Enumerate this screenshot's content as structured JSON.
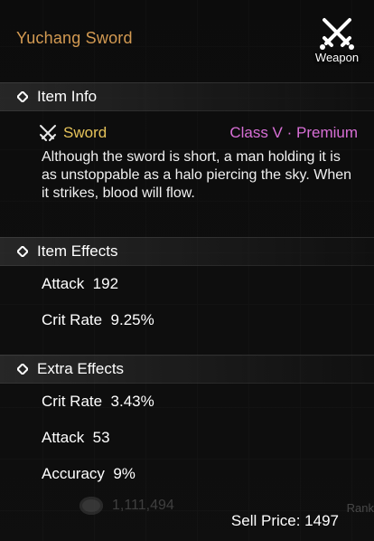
{
  "item": {
    "name": "Yuchang Sword",
    "category_badge": "Weapon",
    "type": "Sword",
    "class_grade": "Class V · Premium",
    "description": "Although the sword is short, a man holding it is as unstoppable as a halo piercing the sky. When it strikes, blood will flow."
  },
  "sections": {
    "info": "Item Info",
    "effects": "Item Effects",
    "extra": "Extra Effects"
  },
  "item_effects": [
    {
      "label": "Attack  192"
    },
    {
      "label": "Crit Rate  9.25%"
    }
  ],
  "extra_effects": [
    {
      "label": "Crit Rate  3.43%"
    },
    {
      "label": "Attack  53"
    },
    {
      "label": "Accuracy  9%"
    }
  ],
  "background": {
    "money": "1,111,494",
    "rank_label": "Rank"
  },
  "footer": {
    "sell_price": "Sell Price: 1497"
  },
  "colors": {
    "title": "#d39a52",
    "type": "#e6c35a",
    "class_grade": "#d86fd6"
  },
  "icons": [
    "crossed-swords-icon",
    "diamond-bullet-icon",
    "sword-type-icon",
    "coin-stack-icon"
  ]
}
